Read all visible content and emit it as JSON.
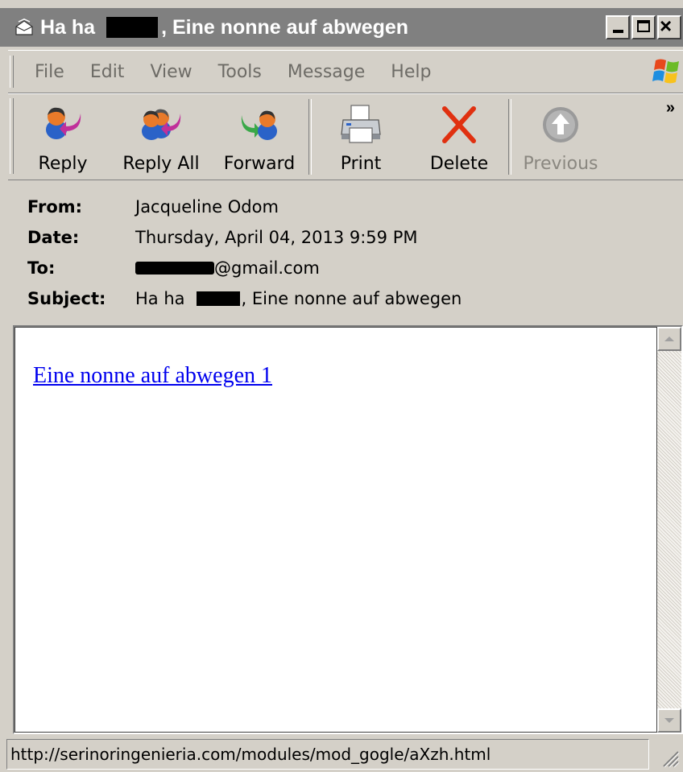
{
  "window": {
    "title_prefix": "Ha ha",
    "title_suffix": ", Eine nonne auf abwegen"
  },
  "menu": [
    "File",
    "Edit",
    "View",
    "Tools",
    "Message",
    "Help"
  ],
  "toolbar": {
    "reply": "Reply",
    "reply_all": "Reply All",
    "forward": "Forward",
    "print": "Print",
    "delete": "Delete",
    "previous": "Previous",
    "overflow": "»"
  },
  "headers": {
    "from_label": "From:",
    "from_value": "Jacqueline Odom",
    "date_label": "Date:",
    "date_value": "Thursday, April 04, 2013 9:59 PM",
    "to_label": "To:",
    "to_value_suffix": "@gmail.com",
    "subject_label": "Subject:",
    "subject_prefix": "Ha ha",
    "subject_suffix": ", Eine nonne auf abwegen"
  },
  "body": {
    "link_text": "Eine nonne auf abwegen 1"
  },
  "status": {
    "url": "http://serinoringenieria.com/modules/mod_gogle/aXzh.html"
  },
  "colors": {
    "titlebar": "#808080",
    "chrome": "#d4d0c8",
    "link": "#0000ee",
    "delete_red": "#e03010"
  },
  "icons": {
    "title": "envelope-icon",
    "reply": "reply-icon",
    "reply_all": "reply-all-icon",
    "forward": "forward-icon",
    "print": "printer-icon",
    "delete": "delete-x-icon",
    "previous": "up-arrow-icon"
  }
}
